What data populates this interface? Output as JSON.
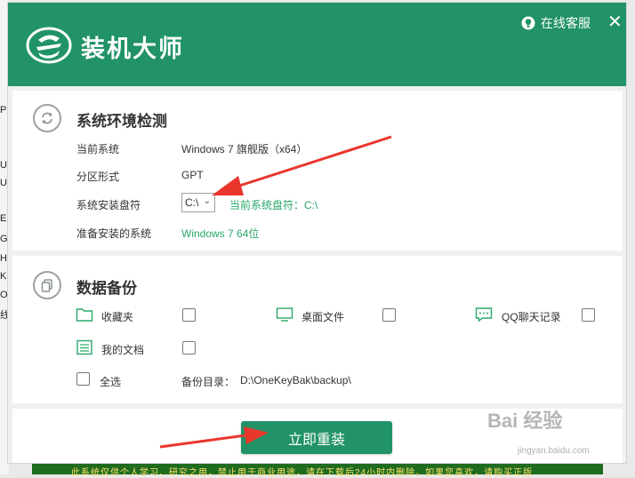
{
  "background": {
    "left_chars": [
      "P",
      "U",
      "U",
      "E",
      "G",
      "H",
      "K",
      "O",
      "线"
    ],
    "bottom_text": "此系统仅供个人学习、研究之用，禁止用于商业用途，请在下载后24小时内删除。如果您喜欢，请购买正版"
  },
  "header": {
    "app_title": "装机大师",
    "support_label": "在线客服",
    "close_glyph": "✕",
    "colors": {
      "brand": "#219367",
      "accent_text": "#2aa86a"
    }
  },
  "system_check": {
    "title": "系统环境检测",
    "rows": [
      {
        "label": "当前系统",
        "value": "Windows 7 旗舰版（x64）"
      },
      {
        "label": "分区形式",
        "value": "GPT"
      },
      {
        "label": "系统安装盘符",
        "value": "C:\\"
      },
      {
        "label": "准备安装的系统",
        "value": "Windows 7 64位"
      }
    ],
    "current_drive_note": "当前系统盘符：C:\\"
  },
  "backup": {
    "title": "数据备份",
    "items": [
      {
        "label": "收藏夹",
        "icon": "folder-icon",
        "checked": false
      },
      {
        "label": "桌面文件",
        "icon": "monitor-icon",
        "checked": false
      },
      {
        "label": "QQ聊天记录",
        "icon": "chat-icon",
        "checked": false
      },
      {
        "label": "我的文档",
        "icon": "document-icon",
        "checked": false
      }
    ],
    "select_all_label": "全选",
    "backup_dir_label": "备份目录：",
    "backup_dir_value": "D:\\OneKeyBak\\backup\\"
  },
  "action": {
    "install_label": "立即重装"
  },
  "watermark": {
    "main": "Bai 经验",
    "sub": "jingyan.baidu.com"
  }
}
